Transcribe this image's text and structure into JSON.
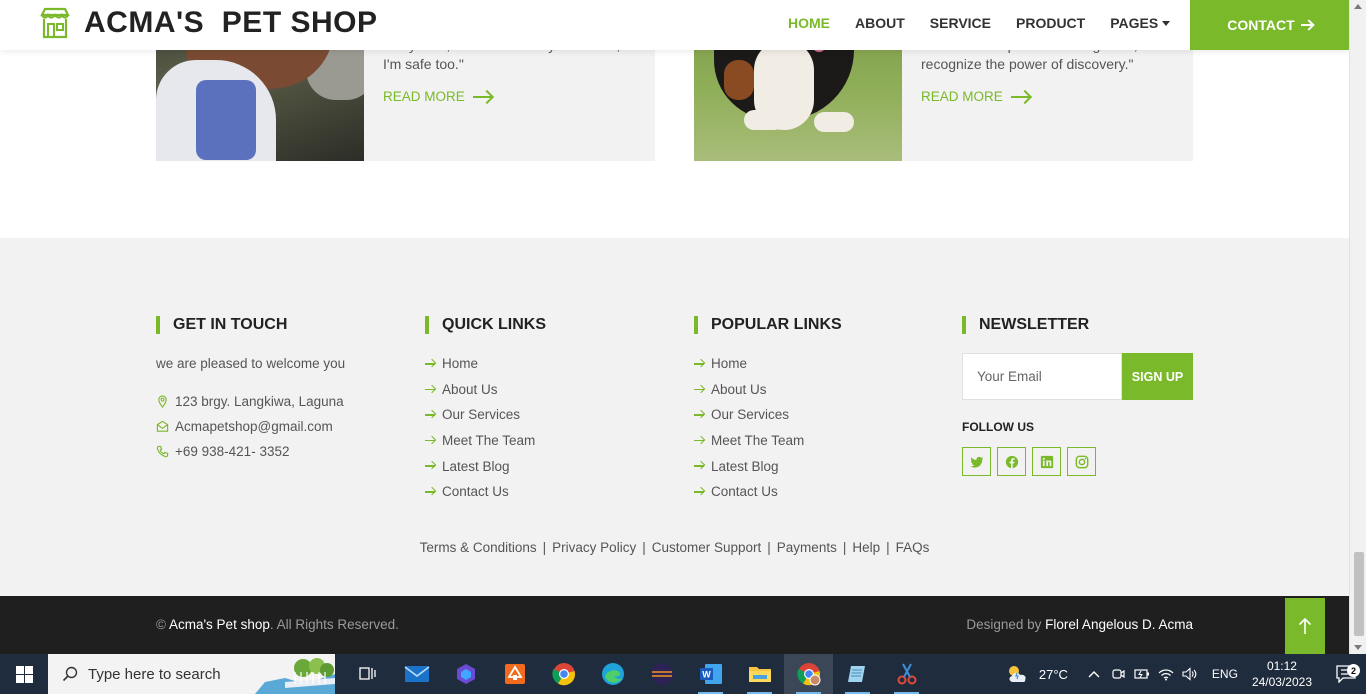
{
  "header": {
    "brand": "ACMA'S  PET SHOP",
    "nav": [
      {
        "label": "HOME",
        "active": true
      },
      {
        "label": "ABOUT"
      },
      {
        "label": "SERVICE"
      },
      {
        "label": "PRODUCT"
      },
      {
        "label": "PAGES"
      }
    ],
    "contact_label": "CONTACT"
  },
  "blog_cards": [
    {
      "text": "\"Stay safe, because when you're safe, I'm safe too.\"",
      "read_more": "READ MORE"
    },
    {
      "text": "\"Discover the power of recognition, and recognize the power of discovery.\"",
      "read_more": "READ MORE"
    }
  ],
  "footer": {
    "get_in_touch": {
      "title": "GET IN TOUCH",
      "intro": "we are pleased to welcome you",
      "address": "123 brgy. Langkiwa, Laguna",
      "email": "Acmapetshop@gmail.com",
      "phone": "+69 938-421- 3352"
    },
    "quick_links": {
      "title": "QUICK LINKS",
      "items": [
        "Home",
        "About Us",
        "Our Services",
        "Meet The Team",
        "Latest Blog",
        "Contact Us"
      ]
    },
    "popular_links": {
      "title": "POPULAR LINKS",
      "items": [
        "Home",
        "About Us",
        "Our Services",
        "Meet The Team",
        "Latest Blog",
        "Contact Us"
      ]
    },
    "newsletter": {
      "title": "NEWSLETTER",
      "placeholder": "Your Email",
      "button": "SIGN UP",
      "follow_label": "FOLLOW US",
      "socials": [
        "twitter-icon",
        "facebook-icon",
        "linkedin-icon",
        "instagram-icon"
      ]
    },
    "legal_links": [
      "Terms & Conditions",
      "Privacy Policy",
      "Customer Support",
      "Payments",
      "Help",
      "FAQs"
    ]
  },
  "bottom_bar": {
    "copyright_symbol": "©",
    "brand": "Acma's Pet shop",
    "rights": ". All Rights Reserved.",
    "designed_by_label": "Designed by",
    "designer": "Florel Angelous D. Acma"
  },
  "taskbar": {
    "search_placeholder": "Type here to search",
    "temperature": "27°C",
    "language": "ENG",
    "time": "01:12",
    "date": "24/03/2023",
    "notification_count": "2"
  },
  "colors": {
    "accent": "#7ab929",
    "footer_bg": "#f2f2f2",
    "bottom_bar_bg": "#1f1f1f"
  }
}
